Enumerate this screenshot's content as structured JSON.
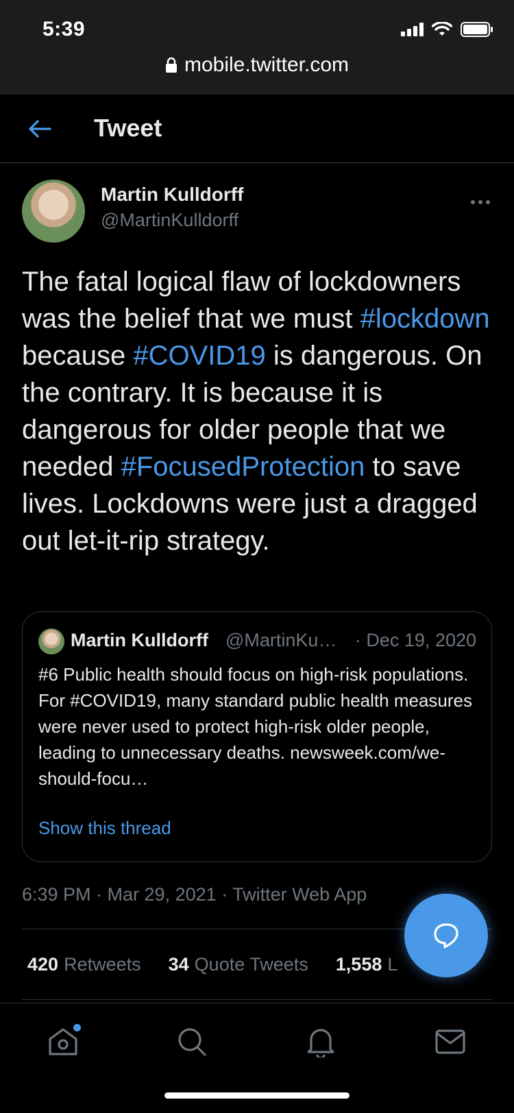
{
  "status_bar": {
    "time": "5:39"
  },
  "browser": {
    "url": "mobile.twitter.com"
  },
  "header": {
    "title": "Tweet"
  },
  "tweet": {
    "author_name": "Martin Kulldorff",
    "author_handle": "@MartinKulldorff",
    "text_parts": [
      {
        "t": "The fatal logical flaw of lockdowners was the belief that we must ",
        "tag": false
      },
      {
        "t": "#lockdown",
        "tag": true
      },
      {
        "t": " because ",
        "tag": false
      },
      {
        "t": "#COVID19",
        "tag": true
      },
      {
        "t": " is dangerous. On the contrary. It is because it is dangerous for older people that we needed ",
        "tag": false
      },
      {
        "t": "#FocusedProtection",
        "tag": true
      },
      {
        "t": " to save lives. Lockdowns were just a dragged out let-it-rip strategy.",
        "tag": false
      }
    ],
    "timestamp": "6:39 PM · Mar 29, 2021 · Twitter Web App"
  },
  "quote": {
    "author_name": "Martin Kulldorff",
    "author_handle": "@MartinKu…",
    "date": "· Dec 19, 2020",
    "text": "#6 Public health should focus on high-risk populations. For #COVID19, many standard public health measures were never used to protect high-risk older people, leading to unnecessary deaths. newsweek.com/we-should-focu…",
    "show_thread": "Show this thread"
  },
  "stats": {
    "retweets_count": "420",
    "retweets_label": "Retweets",
    "quotes_count": "34",
    "quotes_label": "Quote Tweets",
    "likes_count": "1,558",
    "likes_label": "L"
  },
  "colors": {
    "accent": "#4a99e9",
    "background": "#000000",
    "muted": "#6e767d"
  },
  "icons": [
    "back-arrow-icon",
    "lock-icon",
    "more-icon",
    "compose-reply-icon",
    "home-icon",
    "search-icon",
    "notifications-icon",
    "messages-icon"
  ]
}
